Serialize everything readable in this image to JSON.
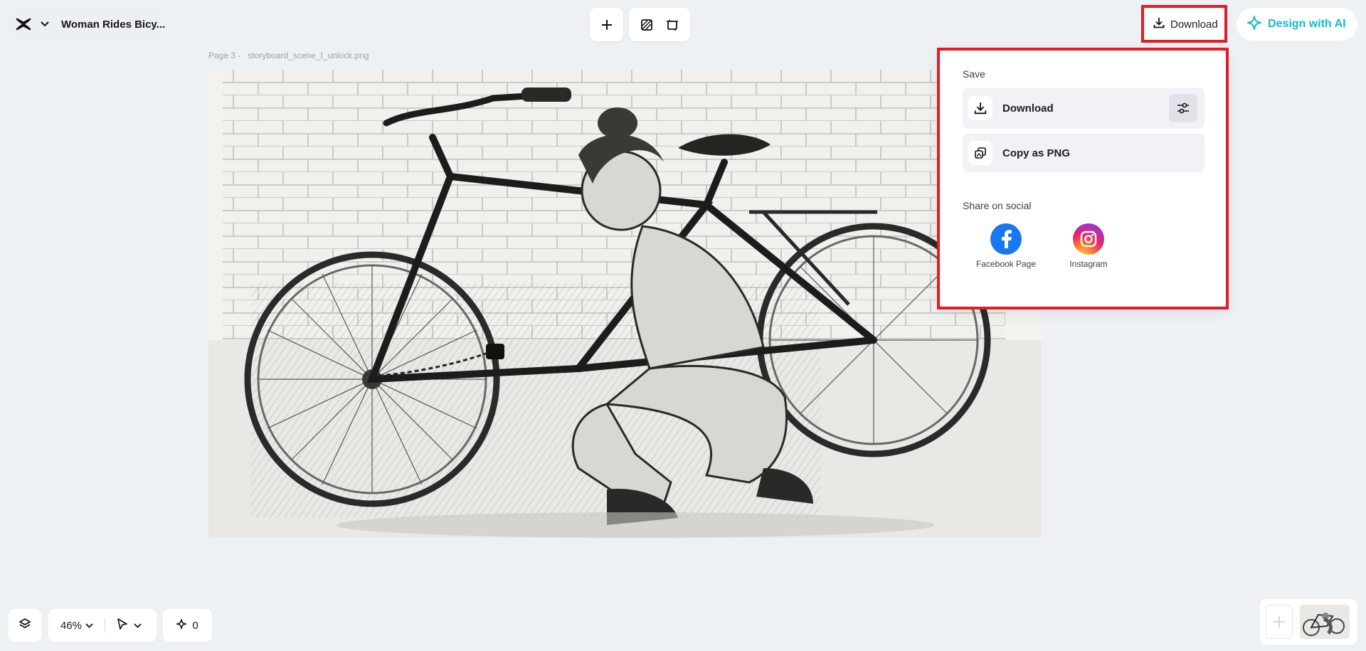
{
  "header": {
    "project_title": "Woman Rides Bicy...",
    "download_label": "Download",
    "design_ai_label": "Design with AI"
  },
  "canvas": {
    "page_label": "Page 3 -",
    "file_name": "storyboard_scene_I_unlock.png"
  },
  "download_panel": {
    "save_title": "Save",
    "download_option": "Download",
    "copy_option": "Copy as PNG",
    "share_title": "Share on social",
    "socials": [
      {
        "label": "Facebook Page"
      },
      {
        "label": "Instagram"
      }
    ]
  },
  "bottom_bar": {
    "zoom": "46%",
    "credits": "0"
  },
  "colors": {
    "highlight": "#e31a27",
    "accent_ai": "#12b8d8",
    "facebook": "#1877f2"
  }
}
